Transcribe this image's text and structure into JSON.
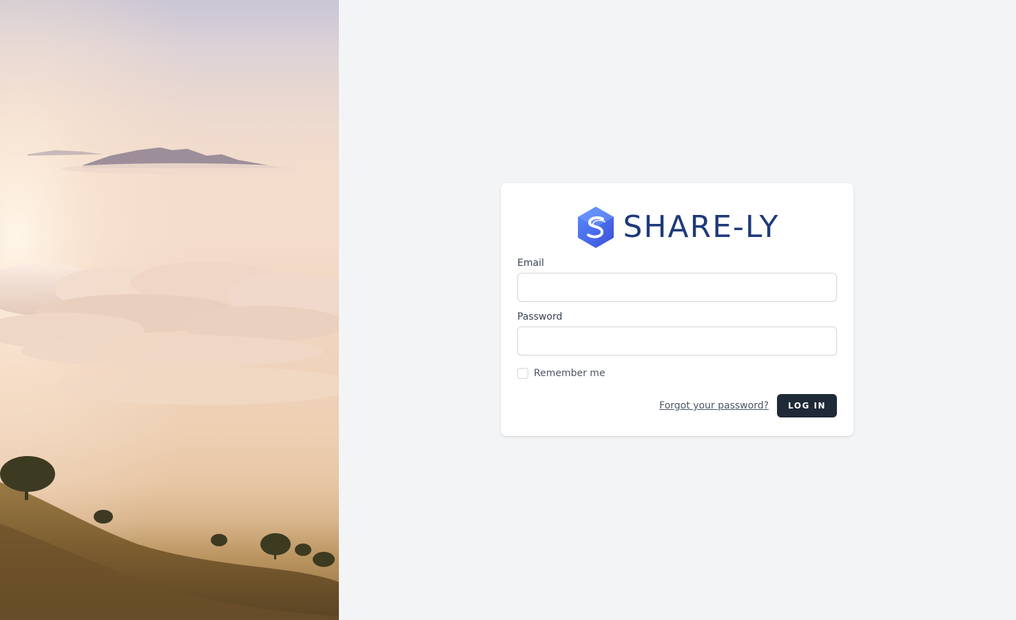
{
  "hero": {
    "image": "mountain-clouds-sunrise-image"
  },
  "logo": {
    "icon": "share-ly-hexagon-icon",
    "text": "SHARE-LY",
    "brand_color": "#1e3a7a",
    "accent_color": "#3b6ff5"
  },
  "form": {
    "email_label": "Email",
    "email_value": "",
    "password_label": "Password",
    "password_value": "",
    "remember_label": "Remember me",
    "remember_checked": false,
    "forgot_link": "Forgot your password?",
    "login_button": "LOG IN",
    "button_color": "#1f2937"
  }
}
